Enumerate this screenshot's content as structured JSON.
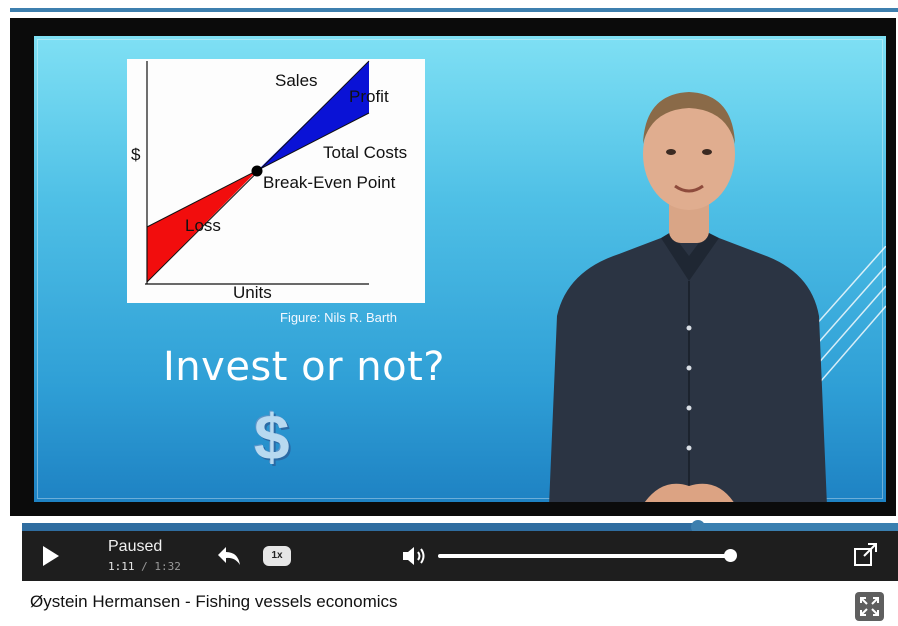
{
  "slide": {
    "figure": {
      "y_axis_label": "$",
      "x_axis_label": "Units",
      "labels": {
        "sales": "Sales",
        "profit": "Profit",
        "total_costs": "Total Costs",
        "break_even": "Break-Even Point",
        "loss": "Loss"
      },
      "colors": {
        "profit": "#0a12d6",
        "loss": "#f20d0d"
      },
      "caption": "Figure: Nils R. Barth"
    },
    "headline": "Invest or not?",
    "dollar_symbol": "$"
  },
  "player": {
    "status": "Paused",
    "time_current": "1:11",
    "time_separator": " / ",
    "time_total": "1:32",
    "progress_fraction": 0.772,
    "volume_fraction": 1.0,
    "speed_label": "1x",
    "icons": {
      "play": "play-icon",
      "replay": "replay-icon",
      "volume": "volume-icon",
      "popout": "popout-icon",
      "expand": "expand-icon"
    },
    "accent_color": "#3d7fae"
  },
  "video_title": "Øystein Hermansen - Fishing vessels economics"
}
